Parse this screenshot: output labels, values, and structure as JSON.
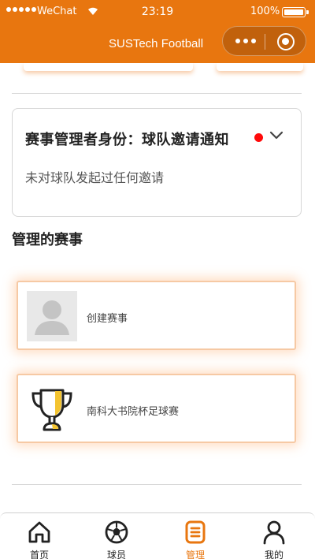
{
  "status_bar": {
    "carrier": "WeChat",
    "time": "23:19",
    "battery": "100%"
  },
  "header": {
    "title": "SUSTech Football"
  },
  "notice": {
    "title": "赛事管理者身份：球队邀请通知",
    "text": "未对球队发起过任何邀请"
  },
  "section": {
    "title": "管理的赛事"
  },
  "events": [
    {
      "label": "创建赛事",
      "icon": "avatar-placeholder-icon"
    },
    {
      "label": "南科大书院杯足球赛",
      "icon": "trophy-icon"
    }
  ],
  "tabbar": {
    "items": [
      {
        "label": "首页",
        "icon": "home-icon"
      },
      {
        "label": "球员",
        "icon": "football-icon"
      },
      {
        "label": "管理",
        "icon": "manage-icon"
      },
      {
        "label": "我的",
        "icon": "profile-icon"
      }
    ],
    "active_index": 2
  },
  "colors": {
    "accent": "#e8760f",
    "notice_dot": "#ff0a0a",
    "card_glow": "#ffa05a"
  }
}
